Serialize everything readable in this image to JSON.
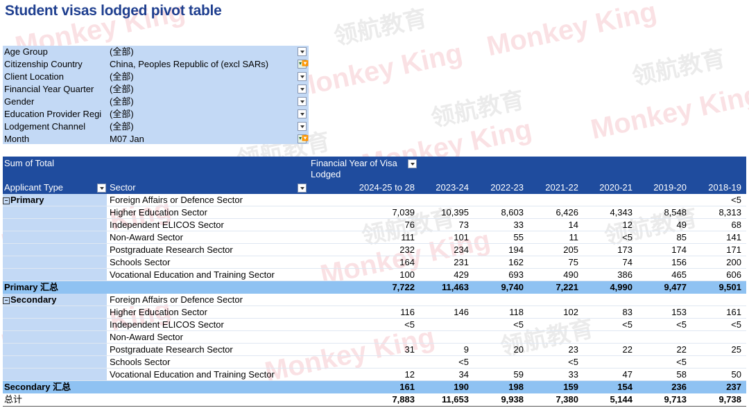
{
  "title": "Student visas lodged pivot table",
  "filters": [
    {
      "label": "Age Group",
      "value": "(全部)",
      "filtered": false
    },
    {
      "label": "Citizenship Country",
      "value": "China, Peoples Republic of (excl SARs)",
      "filtered": true
    },
    {
      "label": "Client Location",
      "value": "(全部)",
      "filtered": false
    },
    {
      "label": "Financial Year Quarter",
      "value": "(全部)",
      "filtered": false
    },
    {
      "label": "Gender",
      "value": "(全部)",
      "filtered": false
    },
    {
      "label": "Education Provider Regi",
      "value": "(全部)",
      "filtered": false
    },
    {
      "label": "Lodgement Channel",
      "value": "(全部)",
      "filtered": false
    },
    {
      "label": "Month",
      "value": "M07 Jan",
      "filtered": true
    }
  ],
  "header": {
    "measure": "Sum of Total",
    "column_field": "Financial Year of Visa Lodged",
    "row_field_1": "Applicant Type",
    "row_field_2": "Sector",
    "columns": [
      "2024-25 to 28",
      "2023-24",
      "2022-23",
      "2021-22",
      "2020-21",
      "2019-20",
      "2018-19"
    ]
  },
  "groups": [
    {
      "name": "Primary",
      "rows": [
        {
          "sector": "Foreign Affairs or Defence Sector",
          "values": [
            "",
            "",
            "",
            "",
            "",
            "",
            "<5"
          ]
        },
        {
          "sector": "Higher Education Sector",
          "values": [
            "7,039",
            "10,395",
            "8,603",
            "6,426",
            "4,343",
            "8,548",
            "8,313"
          ]
        },
        {
          "sector": "Independent ELICOS Sector",
          "values": [
            "76",
            "73",
            "33",
            "14",
            "12",
            "49",
            "68"
          ]
        },
        {
          "sector": "Non-Award Sector",
          "values": [
            "111",
            "101",
            "55",
            "11",
            "<5",
            "85",
            "141"
          ]
        },
        {
          "sector": "Postgraduate Research Sector",
          "values": [
            "232",
            "234",
            "194",
            "205",
            "173",
            "174",
            "171"
          ]
        },
        {
          "sector": "Schools Sector",
          "values": [
            "164",
            "231",
            "162",
            "75",
            "74",
            "156",
            "200"
          ]
        },
        {
          "sector": "Vocational Education and Training Sector",
          "values": [
            "100",
            "429",
            "693",
            "490",
            "386",
            "465",
            "606"
          ]
        }
      ],
      "subtotal_label": "Primary 汇总",
      "subtotal": [
        "7,722",
        "11,463",
        "9,740",
        "7,221",
        "4,990",
        "9,477",
        "9,501"
      ]
    },
    {
      "name": "Secondary",
      "rows": [
        {
          "sector": "Foreign Affairs or Defence Sector",
          "values": [
            "",
            "",
            "",
            "",
            "",
            "",
            ""
          ]
        },
        {
          "sector": "Higher Education Sector",
          "values": [
            "116",
            "146",
            "118",
            "102",
            "83",
            "153",
            "161"
          ]
        },
        {
          "sector": "Independent ELICOS Sector",
          "values": [
            "<5",
            "",
            "<5",
            "",
            "<5",
            "<5",
            "<5"
          ]
        },
        {
          "sector": "Non-Award Sector",
          "values": [
            "",
            "",
            "",
            "",
            "",
            "",
            ""
          ]
        },
        {
          "sector": "Postgraduate Research Sector",
          "values": [
            "31",
            "9",
            "20",
            "23",
            "22",
            "22",
            "25"
          ]
        },
        {
          "sector": "Schools Sector",
          "values": [
            "",
            "<5",
            "",
            "<5",
            "",
            "<5",
            ""
          ]
        },
        {
          "sector": "Vocational Education and Training Sector",
          "values": [
            "12",
            "34",
            "59",
            "33",
            "47",
            "58",
            "50"
          ]
        }
      ],
      "subtotal_label": "Secondary 汇总",
      "subtotal": [
        "161",
        "190",
        "198",
        "159",
        "154",
        "236",
        "237"
      ]
    }
  ],
  "grand_total_label": "总计",
  "grand_total": [
    "7,883",
    "11,653",
    "9,938",
    "7,380",
    "5,144",
    "9,713",
    "9,738"
  ],
  "watermark": {
    "text_en": "Monkey King",
    "text_cn": "领航教育"
  }
}
